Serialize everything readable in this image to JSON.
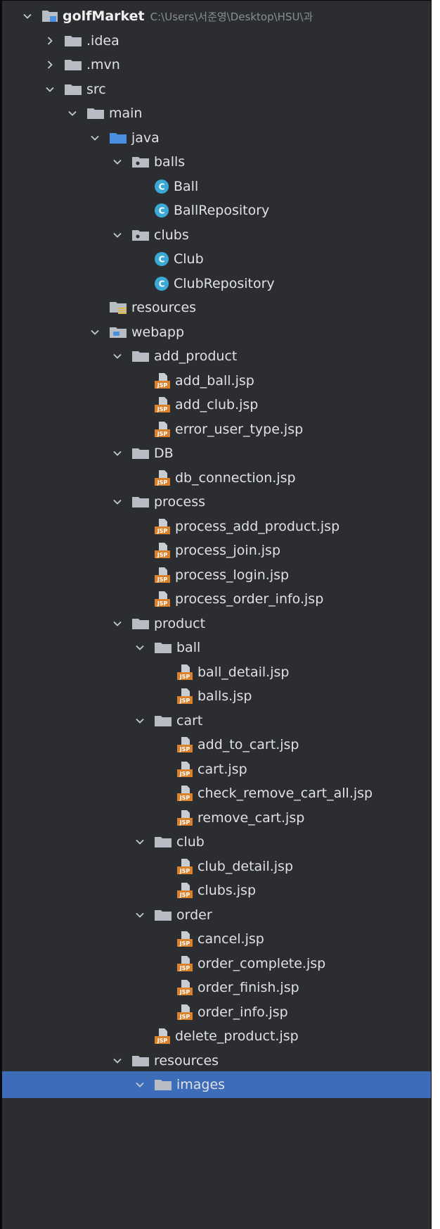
{
  "project": {
    "name": "golfMarket",
    "path": "C:\\Users\\서준영\\Desktop\\HSU\\과"
  },
  "tree": [
    {
      "label": "golfMarket",
      "depth": 0,
      "kind": "project",
      "expanded": true
    },
    {
      "label": ".idea",
      "depth": 1,
      "kind": "folder",
      "expanded": false
    },
    {
      "label": ".mvn",
      "depth": 1,
      "kind": "folder",
      "expanded": false
    },
    {
      "label": "src",
      "depth": 1,
      "kind": "folder",
      "expanded": true
    },
    {
      "label": "main",
      "depth": 2,
      "kind": "folder",
      "expanded": true
    },
    {
      "label": "java",
      "depth": 3,
      "kind": "source-folder",
      "expanded": true
    },
    {
      "label": "balls",
      "depth": 4,
      "kind": "package",
      "expanded": true
    },
    {
      "label": "Ball",
      "depth": 5,
      "kind": "class"
    },
    {
      "label": "BallRepository",
      "depth": 5,
      "kind": "class"
    },
    {
      "label": "clubs",
      "depth": 4,
      "kind": "package",
      "expanded": true
    },
    {
      "label": "Club",
      "depth": 5,
      "kind": "class"
    },
    {
      "label": "ClubRepository",
      "depth": 5,
      "kind": "class"
    },
    {
      "label": "resources",
      "depth": 3,
      "kind": "resources-folder"
    },
    {
      "label": "webapp",
      "depth": 3,
      "kind": "web-folder",
      "expanded": true
    },
    {
      "label": "add_product",
      "depth": 4,
      "kind": "folder",
      "expanded": true
    },
    {
      "label": "add_ball.jsp",
      "depth": 5,
      "kind": "jsp"
    },
    {
      "label": "add_club.jsp",
      "depth": 5,
      "kind": "jsp"
    },
    {
      "label": "error_user_type.jsp",
      "depth": 5,
      "kind": "jsp"
    },
    {
      "label": "DB",
      "depth": 4,
      "kind": "folder",
      "expanded": true
    },
    {
      "label": "db_connection.jsp",
      "depth": 5,
      "kind": "jsp"
    },
    {
      "label": "process",
      "depth": 4,
      "kind": "folder",
      "expanded": true
    },
    {
      "label": "process_add_product.jsp",
      "depth": 5,
      "kind": "jsp"
    },
    {
      "label": "process_join.jsp",
      "depth": 5,
      "kind": "jsp"
    },
    {
      "label": "process_login.jsp",
      "depth": 5,
      "kind": "jsp"
    },
    {
      "label": "process_order_info.jsp",
      "depth": 5,
      "kind": "jsp"
    },
    {
      "label": "product",
      "depth": 4,
      "kind": "folder",
      "expanded": true
    },
    {
      "label": "ball",
      "depth": 5,
      "kind": "folder",
      "expanded": true
    },
    {
      "label": "ball_detail.jsp",
      "depth": 6,
      "kind": "jsp"
    },
    {
      "label": "balls.jsp",
      "depth": 6,
      "kind": "jsp"
    },
    {
      "label": "cart",
      "depth": 5,
      "kind": "folder",
      "expanded": true
    },
    {
      "label": "add_to_cart.jsp",
      "depth": 6,
      "kind": "jsp"
    },
    {
      "label": "cart.jsp",
      "depth": 6,
      "kind": "jsp"
    },
    {
      "label": "check_remove_cart_all.jsp",
      "depth": 6,
      "kind": "jsp"
    },
    {
      "label": "remove_cart.jsp",
      "depth": 6,
      "kind": "jsp"
    },
    {
      "label": "club",
      "depth": 5,
      "kind": "folder",
      "expanded": true
    },
    {
      "label": "club_detail.jsp",
      "depth": 6,
      "kind": "jsp"
    },
    {
      "label": "clubs.jsp",
      "depth": 6,
      "kind": "jsp"
    },
    {
      "label": "order",
      "depth": 5,
      "kind": "folder",
      "expanded": true
    },
    {
      "label": "cancel.jsp",
      "depth": 6,
      "kind": "jsp"
    },
    {
      "label": "order_complete.jsp",
      "depth": 6,
      "kind": "jsp"
    },
    {
      "label": "order_finish.jsp",
      "depth": 6,
      "kind": "jsp"
    },
    {
      "label": "order_info.jsp",
      "depth": 6,
      "kind": "jsp"
    },
    {
      "label": "delete_product.jsp",
      "depth": 5,
      "kind": "jsp"
    },
    {
      "label": "resources",
      "depth": 4,
      "kind": "folder",
      "expanded": true
    },
    {
      "label": "images",
      "depth": 5,
      "kind": "folder",
      "expanded": true,
      "selected": true
    }
  ],
  "colors": {
    "background": "#2b2d30",
    "selection": "#3d6cb8",
    "text": "#dfe1e5",
    "folder": "#b8bcc4",
    "source_folder": "#4a8fe0",
    "class_icon": "#3aa9d6",
    "jsp_orange": "#d9822b"
  },
  "icons": {
    "expanded": "chevron-down-icon",
    "collapsed": "chevron-right-icon",
    "folder": "folder-icon",
    "package": "package-icon",
    "class": "class-icon",
    "jsp": "jsp-file-icon",
    "resources": "resources-folder-icon",
    "web": "web-folder-icon"
  }
}
